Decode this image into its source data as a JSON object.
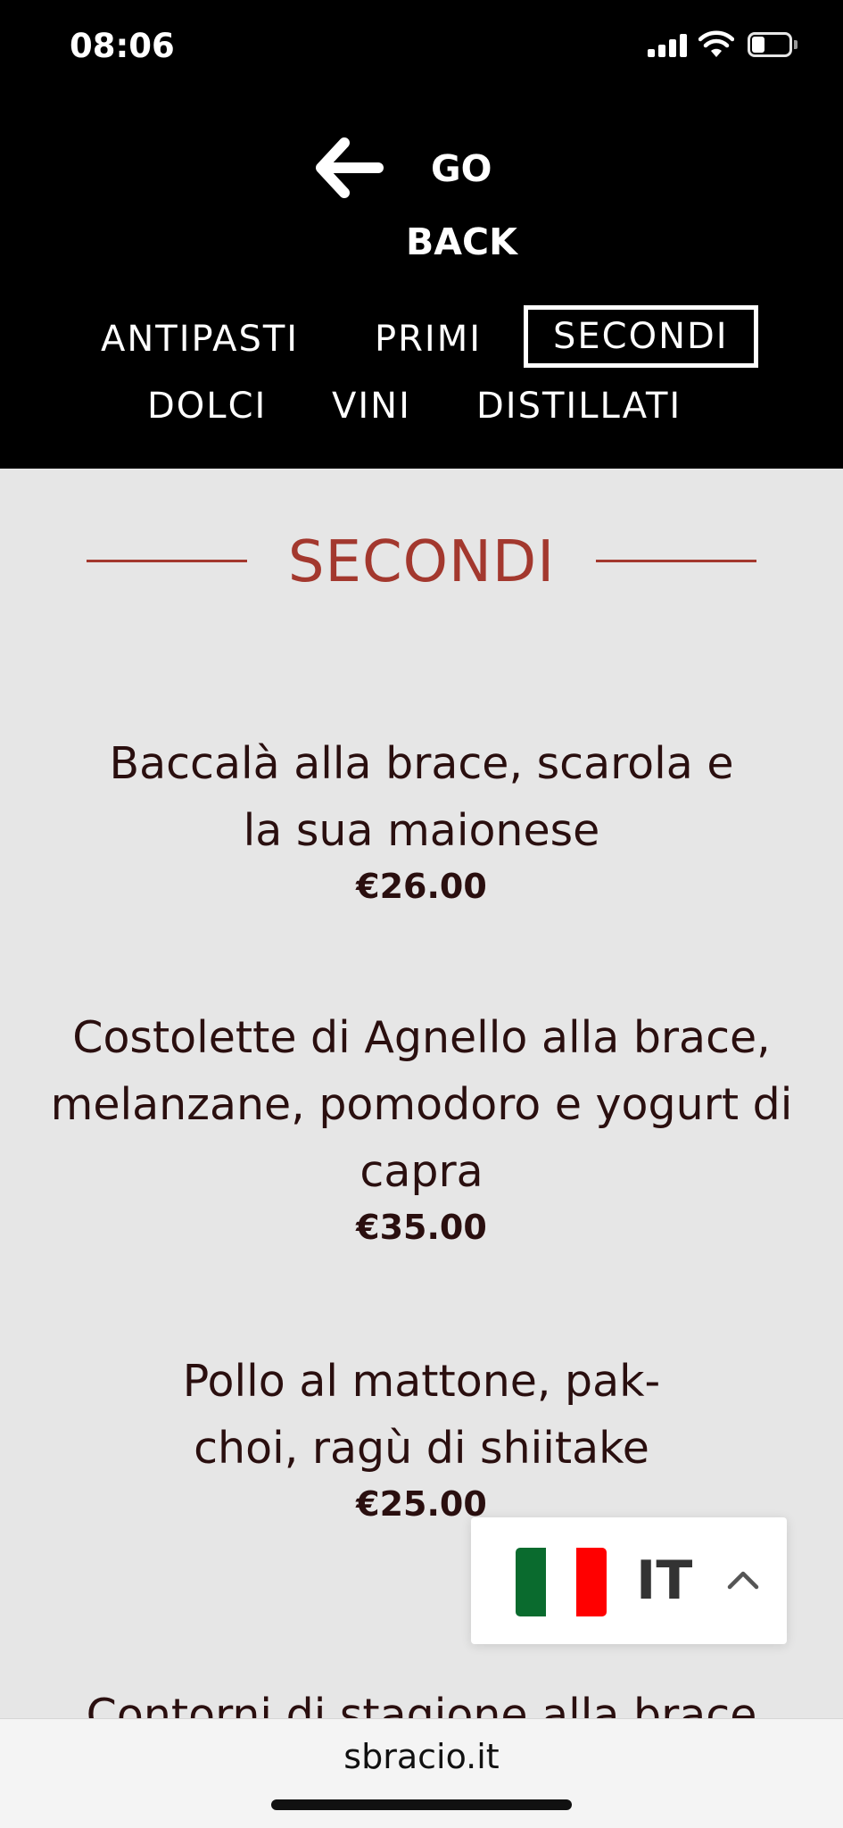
{
  "status_bar": {
    "time": "08:06",
    "icons": [
      "signal-icon",
      "wifi-icon",
      "battery-icon"
    ]
  },
  "header": {
    "back_icon": "arrow-left-icon",
    "back_line1": "GO",
    "back_line2": "BACK",
    "nav": [
      {
        "label": "ANTIPASTI",
        "active": false
      },
      {
        "label": "PRIMI",
        "active": false
      },
      {
        "label": "SECONDI",
        "active": true
      },
      {
        "label": "DOLCI",
        "active": false
      },
      {
        "label": "VINI",
        "active": false
      },
      {
        "label": "DISTILLATI",
        "active": false
      }
    ]
  },
  "section": {
    "title": "SECONDI",
    "items": [
      {
        "name": "Baccalà alla brace, scarola e la sua maionese",
        "price": "€26.00"
      },
      {
        "name": "Costolette di Agnello alla brace, melanzane, pomodoro e yogurt di capra",
        "price": "€35.00"
      },
      {
        "name": "Pollo al mattone, pak-choi, ragù di shiitake",
        "price": "€25.00"
      },
      {
        "name": "Contorni di stagione alla brace"
      }
    ]
  },
  "language_switcher": {
    "code": "IT",
    "flag_icon": "italy-flag-icon",
    "chevron_icon": "chevron-up-icon"
  },
  "browser": {
    "url": "sbracio.it"
  },
  "colors": {
    "header_bg": "#000000",
    "page_bg": "#e6e6e6",
    "accent": "#a3382e",
    "dish_text": "#2a0f0f",
    "flag_green": "#0a6b2e",
    "flag_white": "#ffffff",
    "flag_red": "#ff0000"
  }
}
